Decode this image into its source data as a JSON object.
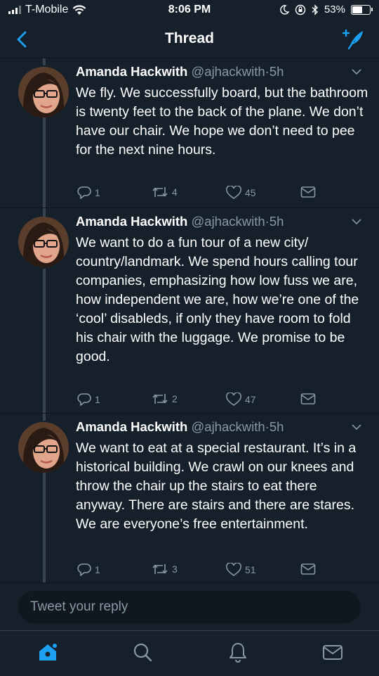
{
  "status_bar": {
    "carrier": "T-Mobile",
    "time": "8:06 PM",
    "battery": "53%",
    "battery_level": 0.53
  },
  "nav": {
    "title": "Thread",
    "back_icon": "chevron-left-icon",
    "compose_icon": "compose-tweet-icon"
  },
  "colors": {
    "background": "#15202b",
    "accent": "#1da1f2",
    "muted_text": "#8899a6",
    "thread_line": "#38444d"
  },
  "tweets": [
    {
      "name": "Amanda Hackwith",
      "handle": "@ajhackwith",
      "dot": "·",
      "time": "5h",
      "text": "We fly. We successfully board, but the bathroom is twenty feet to the back of the plane. We don’t have our chair. We hope we don’t need to pee for the next nine hours.",
      "replies": "1",
      "retweets": "4",
      "likes": "45"
    },
    {
      "name": "Amanda Hackwith",
      "handle": "@ajhackwith",
      "dot": "·",
      "time": "5h",
      "text": "We want to do a fun tour of a new city/ country/landmark. We spend hours calling tour companies, emphasizing how low fuss we are, how independent we are, how we’re one of the ‘cool’ disableds, if only they have room to fold his chair with the luggage. We promise to be good.",
      "replies": "1",
      "retweets": "2",
      "likes": "47"
    },
    {
      "name": "Amanda Hackwith",
      "handle": "@ajhackwith",
      "dot": "·",
      "time": "5h",
      "text": "We want to eat at a special restaurant. It’s in a historical building. We crawl on our knees and throw the chair up the stairs to eat there anyway. There are stairs and there are stares. We are everyone’s free entertainment.",
      "replies": "1",
      "retweets": "3",
      "likes": "51"
    }
  ],
  "reply": {
    "placeholder": "Tweet your reply"
  },
  "tabs": [
    "home-icon",
    "search-icon",
    "notifications-bell-icon",
    "messages-envelope-icon"
  ]
}
